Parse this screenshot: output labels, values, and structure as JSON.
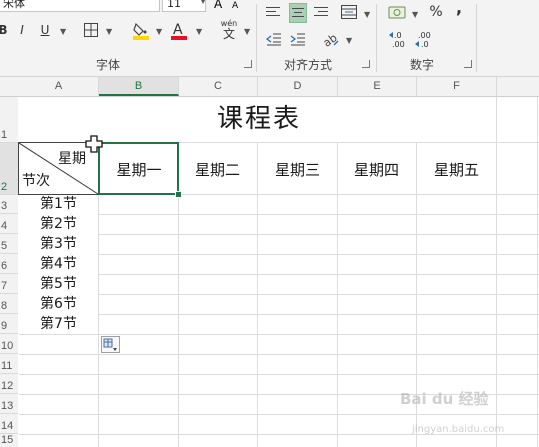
{
  "ribbon": {
    "font_name_partial": "宋体",
    "font_size_partial": "11",
    "bold_label": "B",
    "italic_label": "I",
    "underline_label": "U",
    "font_color_letter": "A",
    "wen_label": "wén",
    "wen_char": "文",
    "percent_label": "%",
    "comma_label": ",",
    "dec_inc_label": ".0→.00",
    "dec_dec_label": ".00→.0",
    "groups": {
      "font": "字体",
      "alignment": "对齐方式",
      "number": "数字"
    },
    "colors": {
      "fill": "#ffd800",
      "font": "#e81123",
      "accent": "#217346"
    }
  },
  "columns": [
    "A",
    "B",
    "C",
    "D",
    "E",
    "F"
  ],
  "rows": [
    "1",
    "2",
    "3",
    "4",
    "5",
    "6",
    "7",
    "8",
    "9",
    "10",
    "11",
    "12",
    "13",
    "14",
    "15"
  ],
  "sheet": {
    "title": "课程表",
    "diagonal_top": "星期",
    "diagonal_bottom": "节次",
    "weekdays": [
      "星期一",
      "星期二",
      "星期三",
      "星期四",
      "星期五"
    ],
    "periods": [
      "第1节",
      "第2节",
      "第3节",
      "第4节",
      "第5节",
      "第6节",
      "第7节"
    ]
  },
  "watermark": {
    "brand": "Bai du 经验",
    "url": "jingyan.baidu.com"
  }
}
